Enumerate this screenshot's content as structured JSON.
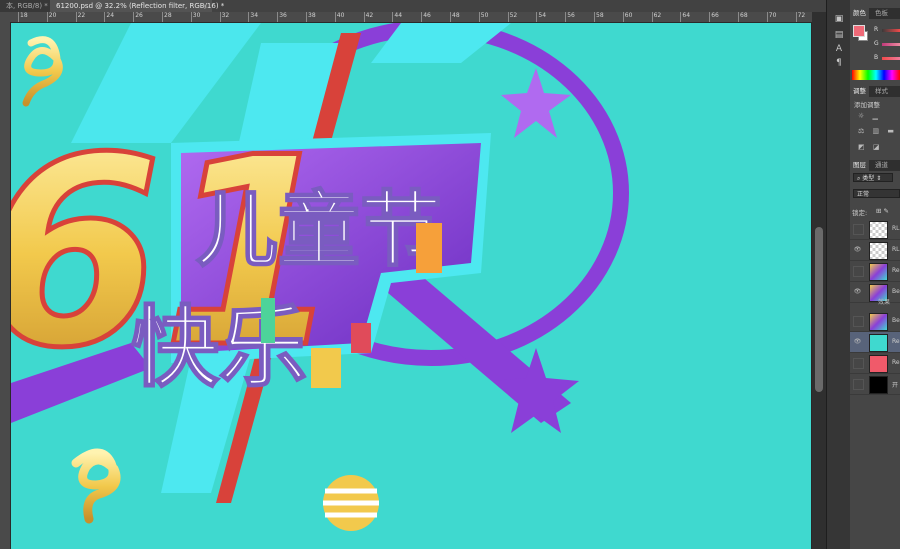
{
  "tabs": [
    {
      "label": "本, RGB/8) *"
    },
    {
      "label": "61200.psd @ 32.2% (Reflection filter, RGB/16) *"
    }
  ],
  "ruler": {
    "h_ticks": [
      "18",
      "20",
      "22",
      "24",
      "26",
      "28",
      "30",
      "32",
      "34",
      "36",
      "38",
      "40",
      "42",
      "44",
      "46",
      "48",
      "50",
      "52",
      "54",
      "56",
      "58",
      "60",
      "62",
      "64",
      "66",
      "68",
      "70",
      "72"
    ]
  },
  "poster": {
    "big_number": "61",
    "line1": "儿童节",
    "line2": "快乐"
  },
  "panels": {
    "color_tabs": [
      "颜色",
      "色板"
    ],
    "channels": [
      "R",
      "G",
      "B"
    ],
    "foreground_color": "#f06a78",
    "adjust_tabs": [
      "调整",
      "样式"
    ],
    "adjust_label": "添加调整",
    "layer_tabs": [
      "图层",
      "通道"
    ],
    "filter_kind": "类型",
    "blend_mode": "正常",
    "lock_label": "锁定:",
    "layers": [
      {
        "name": "RL",
        "visible": false,
        "thumb": "transparent"
      },
      {
        "name": "RL",
        "visible": true,
        "thumb": "transparent"
      },
      {
        "name": "Re",
        "visible": false,
        "thumb": "art"
      },
      {
        "name": "Be",
        "visible": true,
        "thumb": "art"
      },
      {
        "name": "Be",
        "visible": false,
        "thumb": "art"
      },
      {
        "name": "Re",
        "visible": true,
        "thumb": "#3fd9cf",
        "selected": true
      },
      {
        "name": "Re",
        "visible": false,
        "thumb": "#f05a6a"
      },
      {
        "name": "开",
        "visible": false,
        "thumb": "#000000"
      }
    ],
    "effect_label": "效果"
  },
  "colors": {
    "canvas_bg": "#3fd9cf",
    "purple": "#8a3fd8",
    "cyan": "#4de8f0",
    "gold": "#f2c94c"
  }
}
